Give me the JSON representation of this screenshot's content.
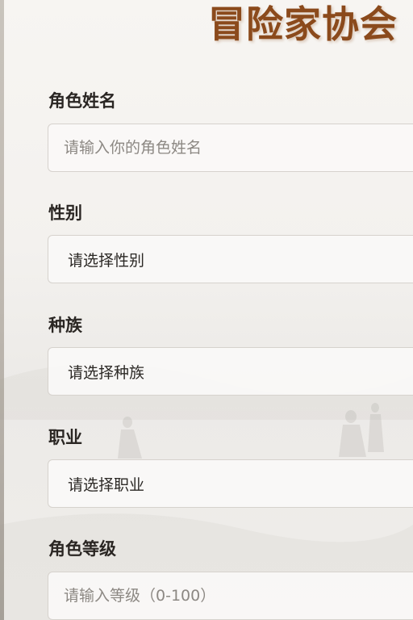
{
  "page": {
    "title": "冒险家协会"
  },
  "form": {
    "name": {
      "label": "角色姓名",
      "placeholder": "请输入你的角色姓名",
      "value": ""
    },
    "gender": {
      "label": "性别",
      "selected": "请选择性别"
    },
    "race": {
      "label": "种族",
      "selected": "请选择种族"
    },
    "class": {
      "label": "职业",
      "selected": "请选择职业"
    },
    "level": {
      "label": "角色等级",
      "placeholder": "请输入等级（0-100）",
      "value": ""
    }
  },
  "colors": {
    "title": "#8b4a1c",
    "label": "#2a2623",
    "placeholder": "#8c8883",
    "field_border": "#d6d2cd"
  }
}
